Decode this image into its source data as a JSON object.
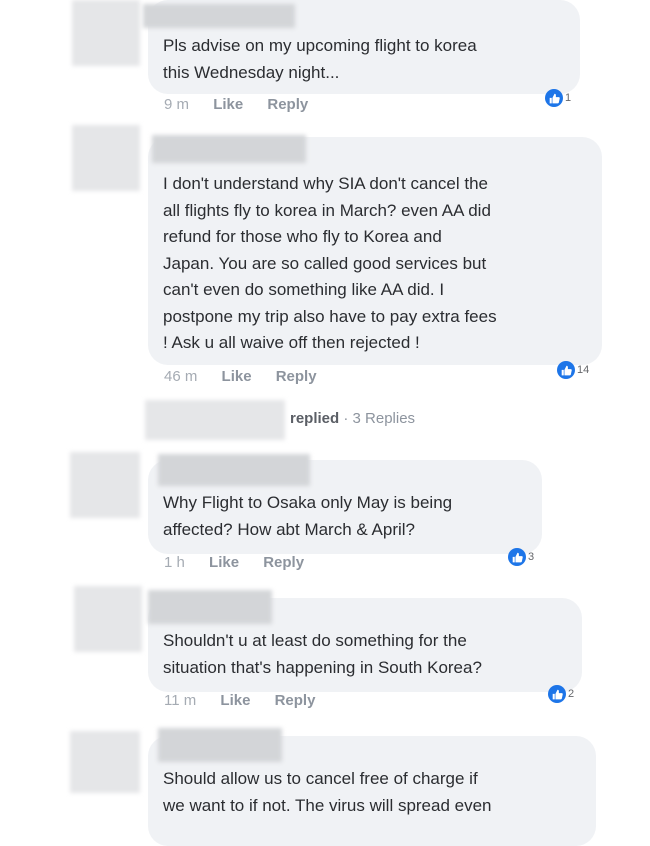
{
  "comments": [
    {
      "text": "Pls advise on my upcoming flight to korea\nthis Wednesday night...",
      "time": "9 m",
      "like_label": "Like",
      "reply_label": "Reply",
      "reactions": "1"
    },
    {
      "text": "I don't understand why SIA don't cancel the\nall flights fly to korea in March?  even AA did\nrefund for those who fly to Korea and\nJapan. You are so called good services but\ncan't even do something like AA did. I\npostpone my trip also have to pay extra fees\n!  Ask u all waive off then rejected !",
      "time": "46 m",
      "like_label": "Like",
      "reply_label": "Reply",
      "reactions": "14"
    },
    {
      "text": "Why Flight to Osaka only May is being\naffected? How abt March & April?",
      "time": "1 h",
      "like_label": "Like",
      "reply_label": "Reply",
      "reactions": "3"
    },
    {
      "text": "Shouldn't u at least do something for the\nsituation that's happening in South Korea?",
      "time": "11 m",
      "like_label": "Like",
      "reply_label": "Reply",
      "reactions": "2"
    },
    {
      "text": "Should allow us to cancel free of charge if\nwe want to if not. The virus will spread even"
    }
  ],
  "replies_summary": {
    "replied": "replied",
    "count": "· 3 Replies"
  },
  "icons": {
    "reaction": "thumbs-up-icon",
    "accent": "#1d75e8"
  }
}
